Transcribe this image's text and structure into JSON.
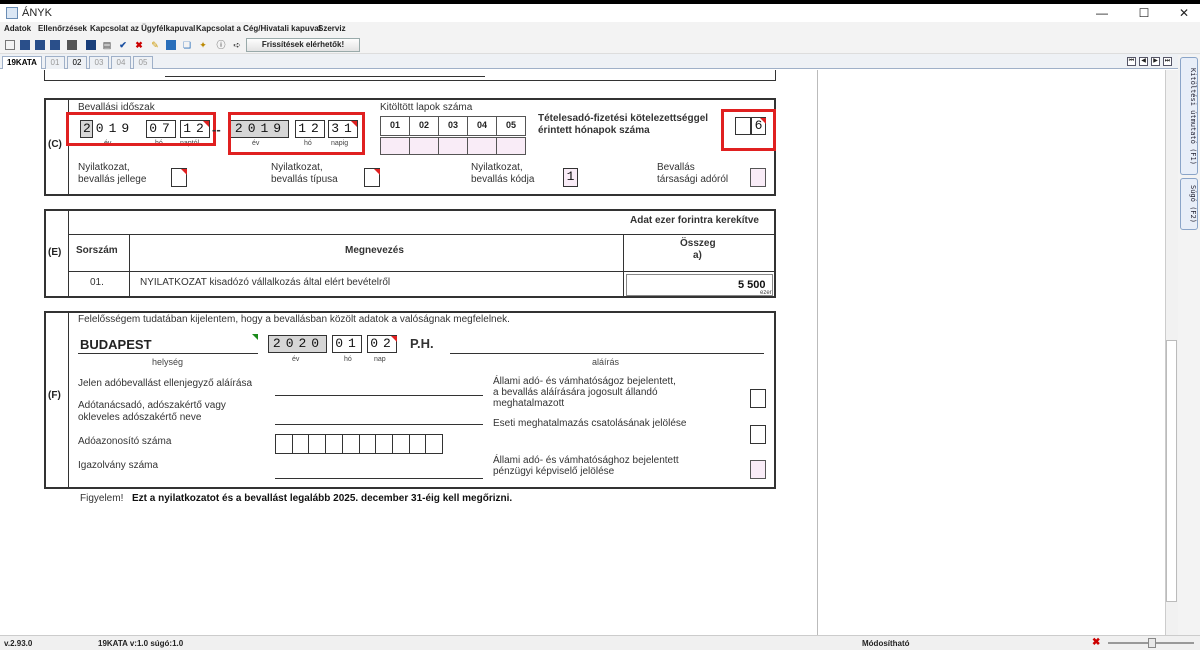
{
  "window": {
    "title": "ÁNYK",
    "min": "—",
    "max": "☐",
    "close": "✕"
  },
  "menu": [
    "Adatok",
    "Ellenőrzések",
    "Kapcsolat az Ügyfélkapuval",
    "Kapcsolat a Cég/Hivatali kapuval",
    "Szerviz"
  ],
  "toolbar": {
    "update_label": "Frissítések elérhetők!"
  },
  "tabs": [
    "19KATA",
    "01",
    "02",
    "03",
    "04",
    "05"
  ],
  "sidetabs": [
    "Kitöltési útmutató (F1)",
    "Súgó (F2)"
  ],
  "status": {
    "version": "v.2.93.0",
    "form": "19KATA v:1.0 súgó:1.0",
    "mode": "Módosítható"
  },
  "sectionC": {
    "label": "(C)",
    "period_label": "Bevallási időszak",
    "from": {
      "year": "2019",
      "month": "07",
      "day": "12"
    },
    "to": {
      "year": "2019",
      "month": "12",
      "day": "31"
    },
    "from_captions": {
      "year": "év",
      "month": "hó",
      "day": "naptól"
    },
    "to_captions": {
      "year": "év",
      "month": "hó",
      "day": "napig"
    },
    "dash": "--",
    "pages_label": "Kitöltött lapok száma",
    "pages": [
      "01",
      "02",
      "03",
      "04",
      "05"
    ],
    "months_label_1": "Tételesadó-fizetési kötelezettséggel",
    "months_label_2": "érintett hónapok száma",
    "months_value": "6",
    "decl_type_1": "Nyilatkozat,",
    "decl_type_2": "bevallás jellege",
    "decl_kind_1": "Nyilatkozat,",
    "decl_kind_2": "bevallás típusa",
    "decl_code_1": "Nyilatkozat,",
    "decl_code_2": "bevallás kódja",
    "decl_code_value": "1",
    "corp_1": "Bevallás",
    "corp_2": "társasági adóról"
  },
  "sectionE": {
    "label": "(E)",
    "header_note": "Adat ezer forintra kerekítve",
    "col_no": "Sorszám",
    "col_name": "Megnevezés",
    "col_amount_1": "Összeg",
    "col_amount_2": "a)",
    "row_no": "01.",
    "row_name": "NYILATKOZAT kisadózó vállalkozás által elért bevételről",
    "row_amount": "5 500",
    "row_unit": "ezer"
  },
  "sectionF": {
    "label": "(F)",
    "statement": "Felelősségem tudatában kijelentem, hogy a bevallásban közölt adatok a valóságnak megfelelnek.",
    "city": "BUDAPEST",
    "city_caption": "helység",
    "date": {
      "year": "2020",
      "month": "01",
      "day": "02"
    },
    "date_captions": {
      "year": "év",
      "month": "hó",
      "day": "nap"
    },
    "ph": "P.H.",
    "signature_caption": "aláírás",
    "countersign": "Jelen adóbevallást ellenjegyző aláírása",
    "advisor_1": "Adótanácsadó,  adószakértő vagy",
    "advisor_2": "okleveles adószakértő neve",
    "tax_id": "Adóazonosító száma",
    "license": "Igazolvány száma",
    "right1_1": "Állami adó- és vámhatóságoz bejelentett,",
    "right1_2": "a bevallás aláírására jogosult állandó",
    "right1_3": "meghatalmazott",
    "right2": "Eseti meghatalmazás csatolásának jelölése",
    "right3_1": "Állami adó- és vámhatósághoz bejelentett",
    "right3_2": "pénzügyi képviselő jelölése"
  },
  "footer": {
    "warning": "Figyelem!",
    "text": "Ezt a nyilatkozatot és a bevallást legalább 2025. december 31-éig kell megőrizni."
  }
}
